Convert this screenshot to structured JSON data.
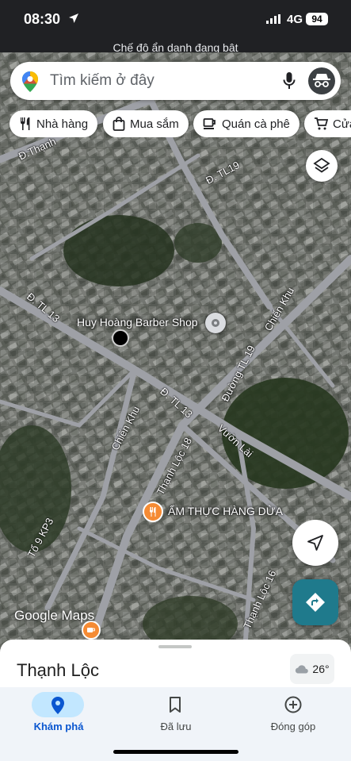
{
  "status_bar": {
    "time": "08:30",
    "network": "4G",
    "battery": "94"
  },
  "incognito_banner": "Chế độ ẩn danh đang bật",
  "search": {
    "placeholder": "Tìm kiếm ở đây"
  },
  "chips": [
    {
      "label": "Nhà hàng",
      "icon": "fork-knife-icon"
    },
    {
      "label": "Mua sắm",
      "icon": "shopping-bag-icon"
    },
    {
      "label": "Quán cà phê",
      "icon": "coffee-cup-icon"
    },
    {
      "label": "Cửa",
      "icon": "cart-icon"
    }
  ],
  "map": {
    "streets": {
      "thanh": "Đ.Thạnh",
      "tl19": "Đ. TL19",
      "tl13_left": "Đ. TL 13",
      "tl13_mid": "Đ. TL 13",
      "duong_tl19": "Đường TL 19",
      "chien_khu_right": "Chiến Khu",
      "chien_khu_left": "Chiến Khu",
      "thanh_loc_18": "Thạnh Lộc 18",
      "vuon_lai": "Vườn Lài",
      "to9kp3": "Tổ 9 KP3",
      "thanh_loc_16": "Thạnh Lộc 16"
    },
    "pois": {
      "barber": "Huy Hoàng Barber Shop",
      "restaurant": "ẨM THỰC HÀNG DỪA"
    },
    "logo": "Google Maps"
  },
  "sheet": {
    "title": "Thạnh Lộc",
    "temperature": "26°"
  },
  "nav": [
    {
      "label": "Khám phá",
      "icon": "explore-pin-icon",
      "active": true
    },
    {
      "label": "Đã lưu",
      "icon": "bookmark-icon",
      "active": false
    },
    {
      "label": "Đóng góp",
      "icon": "add-circle-icon",
      "active": false
    }
  ],
  "colors": {
    "accent": "#0b57d0",
    "directions_fab": "#1f7a8c",
    "active_pill": "#c2e7ff"
  }
}
